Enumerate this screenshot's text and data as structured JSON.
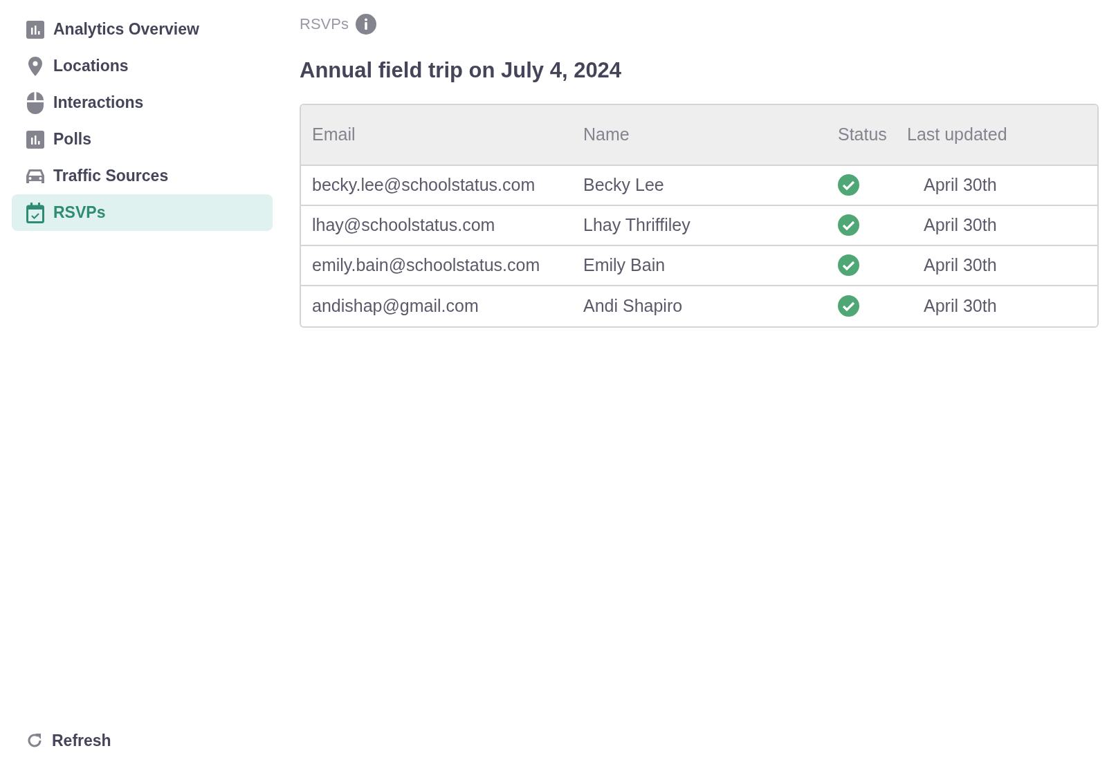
{
  "sidebar": {
    "items": [
      {
        "label": "Analytics Overview",
        "selected": false
      },
      {
        "label": "Locations",
        "selected": false
      },
      {
        "label": "Interactions",
        "selected": false
      },
      {
        "label": "Polls",
        "selected": false
      },
      {
        "label": "Traffic Sources",
        "selected": false
      },
      {
        "label": "RSVPs",
        "selected": true
      }
    ],
    "refresh": "Refresh"
  },
  "breadcrumb": "RSVPs",
  "title": "Annual field trip on July 4, 2024",
  "table": {
    "columns": [
      "Email",
      "Name",
      "Status",
      "Last updated"
    ],
    "rows": [
      {
        "email": "becky.lee@schoolstatus.com",
        "name": "Becky Lee",
        "confirmed": true,
        "last_updated": "April 30th"
      },
      {
        "email": "lhay@schoolstatus.com",
        "name": "Lhay Thriffiley",
        "confirmed": true,
        "last_updated": "April 30th"
      },
      {
        "email": "emily.bain@schoolstatus.com",
        "name": "Emily Bain",
        "confirmed": true,
        "last_updated": "April 30th"
      },
      {
        "email": "andishap@gmail.com",
        "name": "Andi Shapiro",
        "confirmed": true,
        "last_updated": "April 30th"
      }
    ]
  }
}
